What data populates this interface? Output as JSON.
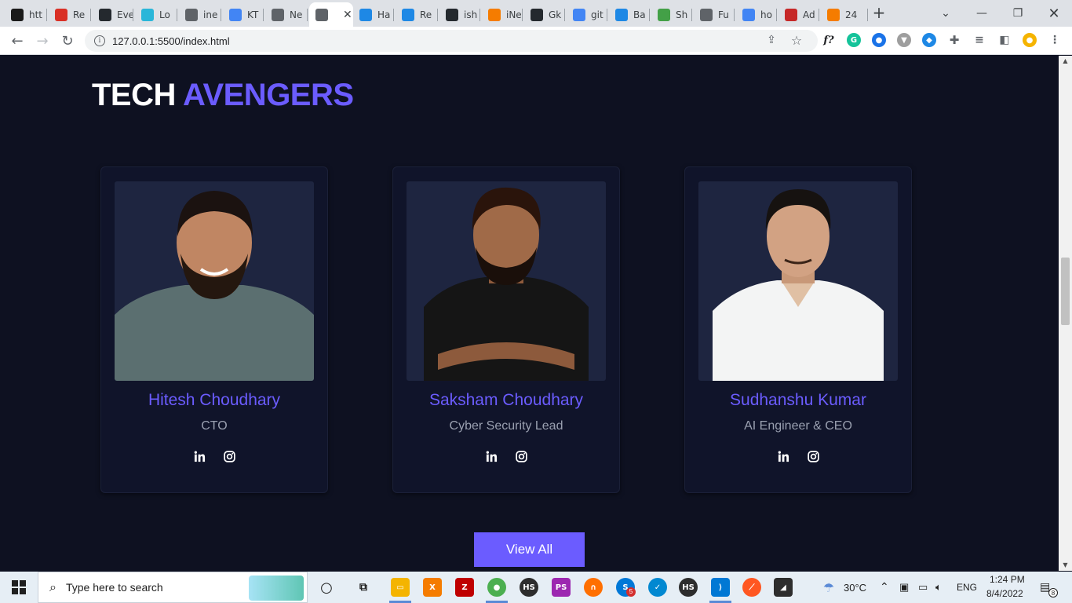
{
  "browser": {
    "tabs": [
      {
        "label": "htt",
        "icon": "hs-icon",
        "color": "#1a1a1a"
      },
      {
        "label": "Re",
        "icon": "gmail-icon",
        "color": "#d93025"
      },
      {
        "label": "Eve",
        "icon": "github-icon",
        "color": "#24292e"
      },
      {
        "label": "Lo",
        "icon": "c-icon",
        "color": "#29b6d9"
      },
      {
        "label": "ine",
        "icon": "globe-icon",
        "color": "#5f6368"
      },
      {
        "label": "KT",
        "icon": "docs-icon",
        "color": "#4285f4"
      },
      {
        "label": "Ne",
        "icon": "chrome-icon",
        "color": "#5f6368"
      },
      {
        "label": "",
        "icon": "globe-icon",
        "color": "#5f6368"
      },
      {
        "label": "Ha",
        "icon": "flutter-icon",
        "color": "#1e88e5"
      },
      {
        "label": "Re",
        "icon": "flutter-icon",
        "color": "#1e88e5"
      },
      {
        "label": "ish",
        "icon": "github-icon",
        "color": "#24292e"
      },
      {
        "label": "iNe",
        "icon": "ineuron-icon",
        "color": "#f57c00"
      },
      {
        "label": "Gk",
        "icon": "github-icon",
        "color": "#24292e"
      },
      {
        "label": "git",
        "icon": "google-icon",
        "color": "#4285f4"
      },
      {
        "label": "Ba",
        "icon": "bolt-icon",
        "color": "#1e88e5"
      },
      {
        "label": "Sh",
        "icon": "sheets-icon",
        "color": "#43a047"
      },
      {
        "label": "Fu",
        "icon": "globe-icon",
        "color": "#5f6368"
      },
      {
        "label": "ho",
        "icon": "google-icon",
        "color": "#4285f4"
      },
      {
        "label": "Ad",
        "icon": "adblock-icon",
        "color": "#c62828"
      },
      {
        "label": "24",
        "icon": "ineuron-icon",
        "color": "#f57c00"
      }
    ],
    "url": "127.0.0.1:5500/index.html"
  },
  "section": {
    "title_part1": "TECH",
    "title_part2": "AVENGERS"
  },
  "team": [
    {
      "name": "Hitesh Choudhary",
      "role": "CTO",
      "shirt": "#5b6f70"
    },
    {
      "name": "Saksham Choudhary",
      "role": "Cyber Security Lead",
      "shirt": "#151515"
    },
    {
      "name": "Sudhanshu Kumar",
      "role": "AI Engineer & CEO",
      "shirt": "#f3f4f4"
    }
  ],
  "view_all_label": "View All",
  "taskbar": {
    "search_placeholder": "Type here to search",
    "temperature": "30°C",
    "language": "ENG",
    "time": "1:24 PM",
    "date": "8/4/2022",
    "notifications": "8",
    "badge_count": "5"
  },
  "colors": {
    "accent": "#6b5cff",
    "page_bg": "#0e1121",
    "card_bg": "#10142a"
  }
}
